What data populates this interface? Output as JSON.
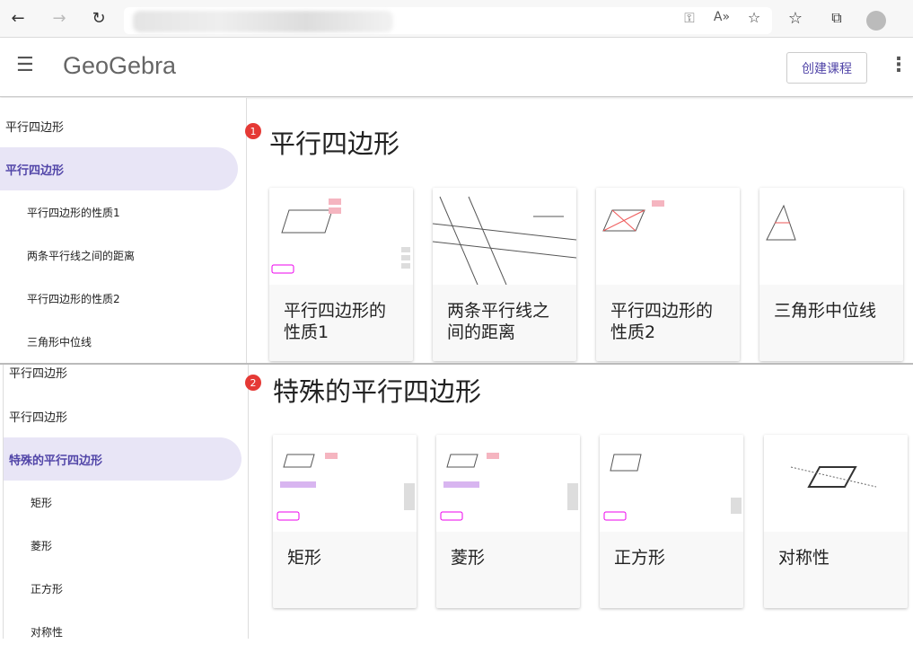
{
  "browser": {
    "icons": [
      "back-icon",
      "forward-icon",
      "refresh-icon",
      "key-icon",
      "read-aloud-icon",
      "add-favorite-icon",
      "favorites-icon",
      "collections-icon",
      "profile-icon"
    ]
  },
  "header": {
    "logo": "GeoGebra",
    "create_button": "创建课程"
  },
  "section1": {
    "badge": "1",
    "title": "平行四边形",
    "sidebar": [
      {
        "label": "平行四边形"
      },
      {
        "label": "平行四边形",
        "selected": true
      },
      {
        "label": "平行四边形的性质1"
      },
      {
        "label": "两条平行线之间的距离"
      },
      {
        "label": "平行四边形的性质2"
      },
      {
        "label": "三角形中位线"
      }
    ],
    "cards": [
      {
        "title": "平行四边形的性质1"
      },
      {
        "title": "两条平行线之间的距离"
      },
      {
        "title": "平行四边形的性质2"
      },
      {
        "title": "三角形中位线"
      }
    ]
  },
  "section2": {
    "badge": "2",
    "title": "特殊的平行四边形",
    "sidebar": [
      {
        "label": "平行四边形"
      },
      {
        "label": "平行四边形"
      },
      {
        "label": "特殊的平行四边形",
        "selected": true
      },
      {
        "label": "矩形"
      },
      {
        "label": "菱形"
      },
      {
        "label": "正方形"
      },
      {
        "label": "对称性"
      }
    ],
    "cards": [
      {
        "title": "矩形"
      },
      {
        "title": "菱形"
      },
      {
        "title": "正方形"
      },
      {
        "title": "对称性"
      }
    ]
  },
  "colors": {
    "accent": "#5145a8",
    "selected_bg": "#e8e5f6",
    "badge": "#e53935"
  }
}
